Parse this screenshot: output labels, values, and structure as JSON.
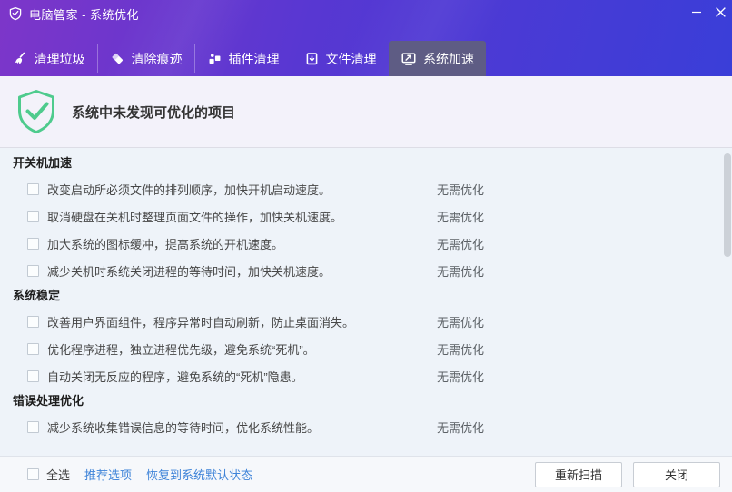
{
  "window": {
    "title": "电脑管家 - 系统优化"
  },
  "tabs": [
    {
      "label": "清理垃圾",
      "icon": "broom-icon",
      "active": false
    },
    {
      "label": "清除痕迹",
      "icon": "eraser-icon",
      "active": false
    },
    {
      "label": "插件清理",
      "icon": "plugin-blocks-icon",
      "active": false
    },
    {
      "label": "文件清理",
      "icon": "file-box-icon",
      "active": false
    },
    {
      "label": "系统加速",
      "icon": "monitor-speedup-icon",
      "active": true
    }
  ],
  "summary": {
    "message": "系统中未发现可优化的项目",
    "icon": "shield-check-icon"
  },
  "sections": [
    {
      "title": "开关机加速",
      "items": [
        {
          "text": "改变启动所必须文件的排列顺序，加快开机启动速度。",
          "status": "无需优化",
          "checked": false
        },
        {
          "text": "取消硬盘在关机时整理页面文件的操作，加快关机速度。",
          "status": "无需优化",
          "checked": false
        },
        {
          "text": "加大系统的图标缓冲，提高系统的开机速度。",
          "status": "无需优化",
          "checked": false
        },
        {
          "text": "减少关机时系统关闭进程的等待时间，加快关机速度。",
          "status": "无需优化",
          "checked": false
        }
      ]
    },
    {
      "title": "系统稳定",
      "items": [
        {
          "text": "改善用户界面组件，程序异常时自动刷新，防止桌面消失。",
          "status": "无需优化",
          "checked": false
        },
        {
          "text": "优化程序进程，独立进程优先级，避免系统“死机”。",
          "status": "无需优化",
          "checked": false
        },
        {
          "text": "自动关闭无反应的程序，避免系统的“死机”隐患。",
          "status": "无需优化",
          "checked": false
        }
      ]
    },
    {
      "title": "错误处理优化",
      "items": [
        {
          "text": "减少系统收集错误信息的等待时间，优化系统性能。",
          "status": "无需优化",
          "checked": false
        }
      ]
    }
  ],
  "footer": {
    "select_all_label": "全选",
    "recommended_link": "推荐选项",
    "restore_link": "恢复到系统默认状态",
    "rescan_button": "重新扫描",
    "close_button": "关闭"
  },
  "colors": {
    "titlebar_gradient_start": "#7d36c9",
    "titlebar_gradient_end": "#3a3ed8",
    "active_tab_bg": "#5e5c84",
    "success_green": "#4ecb8d",
    "link_blue": "#3e83d8",
    "status_text": "#5c6166"
  }
}
